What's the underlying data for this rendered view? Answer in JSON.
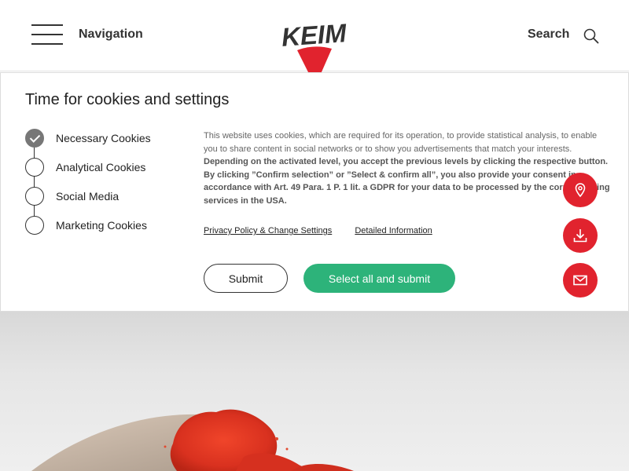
{
  "header": {
    "nav_label": "Navigation",
    "logo_text": "KEIM",
    "search_label": "Search"
  },
  "cookie": {
    "title": "Time for cookies and settings",
    "levels": [
      {
        "label": "Necessary Cookies",
        "checked": true
      },
      {
        "label": "Analytical Cookies",
        "checked": false
      },
      {
        "label": "Social Media",
        "checked": false
      },
      {
        "label": "Marketing Cookies",
        "checked": false
      }
    ],
    "desc_normal": "This website uses cookies, which are required for its operation, to provide statistical analysis, to enable you to share content in social networks or to show you advertisements that match your interests.",
    "desc_bold": "Depending on the activated level, you accept the previous levels by clicking the respective button. By clicking ”Confirm selection” or ”Select & confirm all”, you also provide your consent in accordance with Art. 49 Para. 1 P. 1 lit. a GDPR for your data to be processed by the corresponding services in the USA.",
    "link_privacy": "Privacy Policy & Change Settings",
    "link_details": "Detailed Information",
    "submit_label": "Submit",
    "select_all_label": "Select all and submit"
  },
  "colors": {
    "accent_red": "#e1232e",
    "accent_green": "#2db37a"
  },
  "side_actions": [
    {
      "icon": "location-pin-icon"
    },
    {
      "icon": "download-icon"
    },
    {
      "icon": "mail-icon"
    }
  ]
}
